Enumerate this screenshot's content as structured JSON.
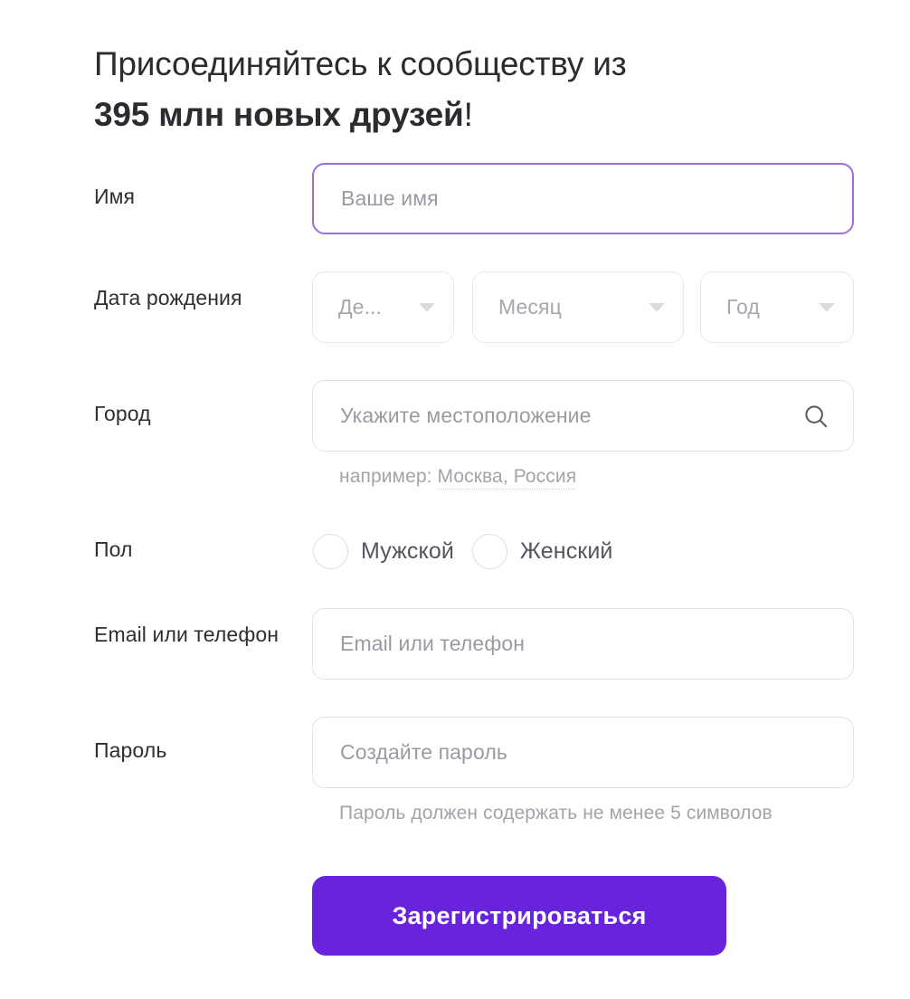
{
  "heading": {
    "line1": "Присоединяйтесь к сообществу из",
    "line2_strong": "395 млн новых друзей",
    "line2_bang": "!"
  },
  "form": {
    "name": {
      "label": "Имя",
      "placeholder": "Ваше имя",
      "value": ""
    },
    "birthdate": {
      "label": "Дата рождения",
      "day": "Де...",
      "month": "Месяц",
      "year": "Год"
    },
    "city": {
      "label": "Город",
      "placeholder": "Укажите местоположение",
      "value": "",
      "icon": "search-icon",
      "hint_prefix": "например: ",
      "hint_example": "Москва, Россия"
    },
    "gender": {
      "label": "Пол",
      "options": [
        {
          "label": "Мужской",
          "selected": false
        },
        {
          "label": "Женский",
          "selected": false
        }
      ]
    },
    "email": {
      "label": "Email или телефон",
      "placeholder": "Email или телефон",
      "value": ""
    },
    "password": {
      "label": "Пароль",
      "placeholder": "Создайте пароль",
      "value": "",
      "hint": "Пароль должен содержать не менее 5 символов"
    },
    "submit": {
      "label": "Зарегистрироваться"
    }
  },
  "colors": {
    "brand_purple": "#6a23dc",
    "focus_border": "#9b6fe0",
    "label_text": "#2e2e33",
    "placeholder_text": "#9a9aa2",
    "hint_text": "#a3a3aa",
    "border": "#e2e2e5"
  }
}
